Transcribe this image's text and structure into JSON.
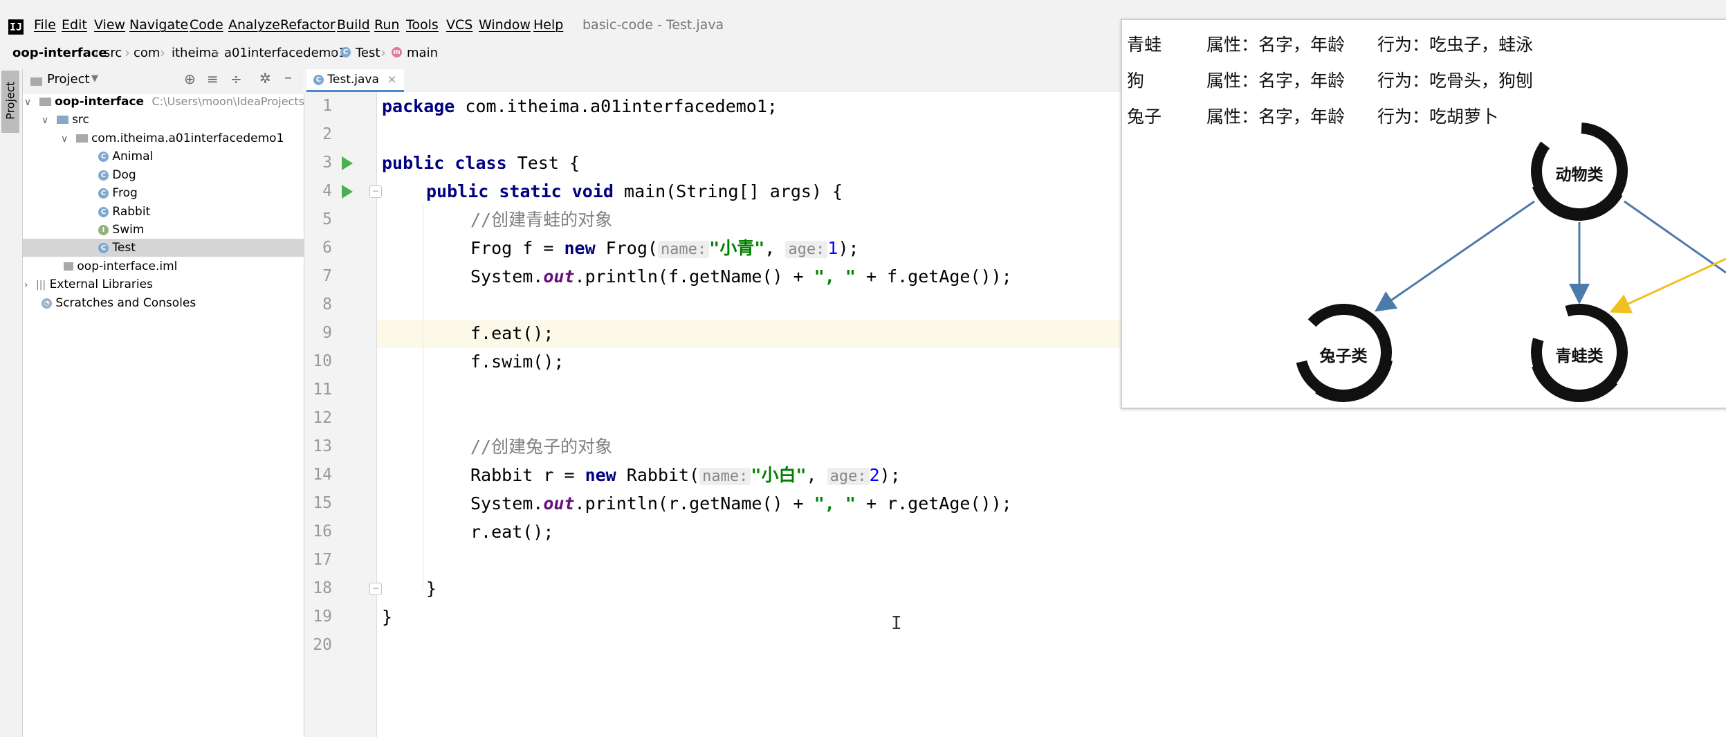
{
  "window": {
    "title": "basic-code - Test.java",
    "app_icon": "intellij-logo-icon"
  },
  "menu": [
    "File",
    "Edit",
    "View",
    "Navigate",
    "Code",
    "Analyze",
    "Refactor",
    "Build",
    "Run",
    "Tools",
    "VCS",
    "Window",
    "Help"
  ],
  "breadcrumb": [
    "oop-interface",
    "src",
    "com",
    "itheima",
    "a01interfacedemo1",
    "Test",
    "main"
  ],
  "toolstrip": {
    "project_tab": "Project"
  },
  "project_panel": {
    "title": "Project",
    "root": {
      "name": "oop-interface",
      "path": "C:\\Users\\moon\\IdeaProjects\\b"
    },
    "src": "src",
    "package": "com.itheima.a01interfacedemo1",
    "classes": [
      {
        "name": "Animal",
        "kind": "C"
      },
      {
        "name": "Dog",
        "kind": "C"
      },
      {
        "name": "Frog",
        "kind": "C"
      },
      {
        "name": "Rabbit",
        "kind": "C"
      },
      {
        "name": "Swim",
        "kind": "I"
      },
      {
        "name": "Test",
        "kind": "C",
        "selected": true
      }
    ],
    "iml": "oop-interface.iml",
    "external": "External Libraries",
    "scratches": "Scratches and Consoles"
  },
  "editor": {
    "tab": "Test.java",
    "current_line": 9,
    "lines": {
      "l1": {
        "kw": "package",
        "rest": " com.itheima.a01interfacedemo1;"
      },
      "l3": {
        "kw1": "public",
        "kw2": "class",
        "rest": " Test {"
      },
      "l4": {
        "kw1": "public",
        "kw2": "static",
        "kw3": "void",
        "rest": " main(String[] args) {"
      },
      "l5": {
        "comment": "//创建青蛙的对象"
      },
      "l6": {
        "a": "Frog f = ",
        "kw": "new",
        "b": " Frog(",
        "hint1": "name:",
        "str": "\"小青\"",
        "c": ", ",
        "hint2": "age:",
        "num": "1",
        "d": ");"
      },
      "l7": {
        "a": "System.",
        "fld": "out",
        "b": ".println(f.getName() + ",
        "str": "\", \"",
        "c": " + f.getAge());"
      },
      "l9": {
        "a": "f.eat();"
      },
      "l10": {
        "a": "f.swim();"
      },
      "l13": {
        "comment": "//创建兔子的对象"
      },
      "l14": {
        "a": "Rabbit r = ",
        "kw": "new",
        "b": " Rabbit(",
        "hint1": "name:",
        "str": "\"小白\"",
        "c": ", ",
        "hint2": "age:",
        "num": "2",
        "d": ");"
      },
      "l15": {
        "a": "System.",
        "fld": "out",
        "b": ".println(r.getName() + ",
        "str": "\", \"",
        "c": " + r.getAge());"
      },
      "l16": {
        "a": "r.eat();"
      },
      "l18": {
        "a": "}"
      },
      "l19": {
        "a": "}"
      }
    }
  },
  "overlay": {
    "rows": [
      {
        "animal": "青蛙",
        "attrs": "属性：名字，年龄",
        "behavior": "行为：吃虫子，蛙泳"
      },
      {
        "animal": "狗",
        "attrs": "属性：名字，年龄",
        "behavior": "行为：吃骨头，狗刨"
      },
      {
        "animal": "兔子",
        "attrs": "属性：名字，年龄",
        "behavior": "行为：吃胡萝卜"
      }
    ],
    "diagram": {
      "parent": "动物类",
      "child_left": "兔子类",
      "child_mid": "青蛙类",
      "arrow_color": "#4a7bab",
      "highlight_arrow_color": "#f0c020"
    }
  }
}
